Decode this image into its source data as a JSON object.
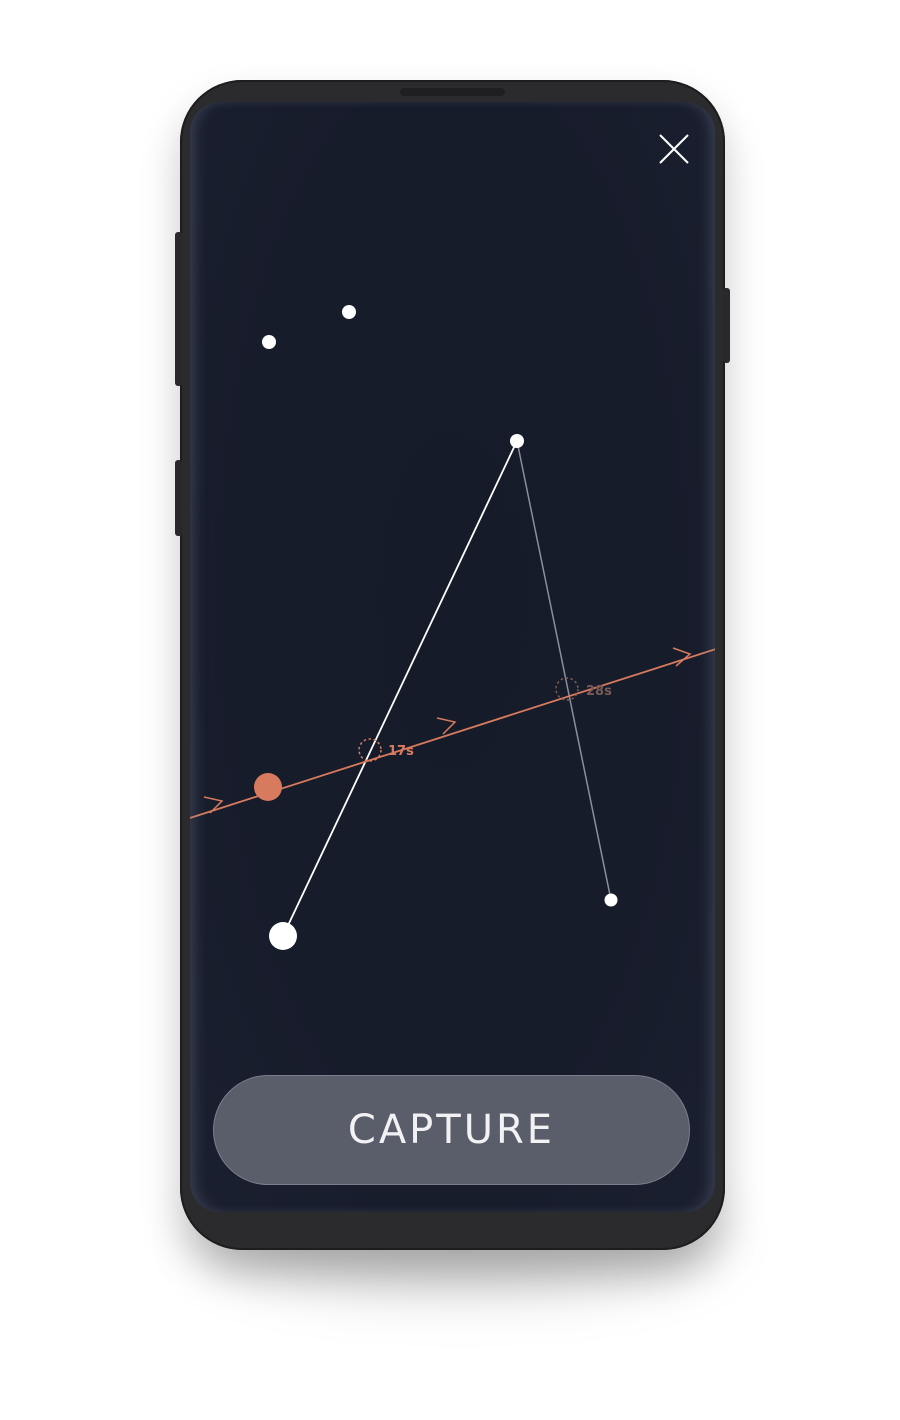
{
  "screen": {
    "close_icon": "close-icon",
    "capture_button_label": "CAPTURE"
  },
  "timers": [
    {
      "label": "17s",
      "color": "#d87a5e"
    },
    {
      "label": "28s",
      "color": "#7a5a55"
    }
  ],
  "colors": {
    "background": "#171c2b",
    "orbit": "#d87a5e",
    "satellite": "#d87a5e",
    "star": "#ffffff",
    "constellation_line": "#ffffff",
    "faint_line": "#8a8f9e",
    "button": "#5a5e6a"
  }
}
